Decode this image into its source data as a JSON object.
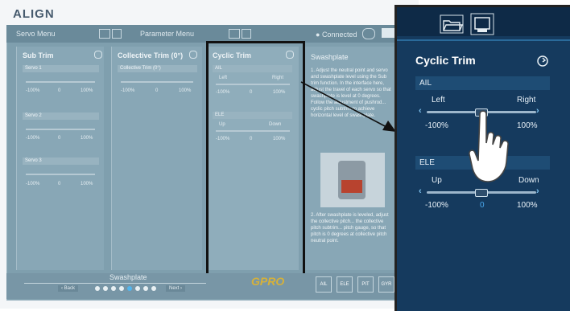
{
  "app": {
    "logo": "ALIGN",
    "menu_left": "Servo Menu",
    "menu_mid": "Parameter Menu",
    "connection_status": "Connected"
  },
  "columns": {
    "sub_trim": {
      "title": "Sub Trim",
      "servos": [
        "Servo 1",
        "Servo 2",
        "Servo 3"
      ],
      "min": "-100%",
      "mid": "0",
      "max": "100%"
    },
    "collective_trim": {
      "title": "Collective Trim (0°)",
      "label": "Collective Trim (0°)",
      "min": "-100%",
      "mid": "0",
      "max": "100%"
    },
    "cyclic_trim_small": {
      "title": "Cyclic Trim",
      "ail": "AIL",
      "ele": "ELE",
      "left": "Left",
      "right": "Right",
      "up": "Up",
      "down": "Down",
      "min": "-100%",
      "mid": "0",
      "max": "100%"
    },
    "swashplate": {
      "title": "Swashplate",
      "step1": "1. Adjust the neutral point and servo and swashplate level using the Sub trim function. In the interface here, adjust the travel of each servo so that swashplate is level at 0 degrees. Follow the adjustment of pushrod... cyclic pitch subtrim to achieve horizontal level of swashplate.",
      "step2": "2. After swashplate is leveled, adjust the collective pitch... the collective pitch subtrim... pitch gauge, so that pitch is 0 degrees at collective pitch neutral point."
    }
  },
  "bottom": {
    "label": "Swashplate",
    "back": "Back",
    "next": "Next",
    "page_count": 8,
    "active_page": 5,
    "brand": "GPRO",
    "icons": [
      "AIL",
      "ELE",
      "PIT",
      "GYR"
    ]
  },
  "zoom": {
    "title": "Cyclic Trim",
    "ail_label": "AIL",
    "left": "Left",
    "right": "Right",
    "ail_min": "-100%",
    "ail_max": "100%",
    "ele_label": "ELE",
    "up": "Up",
    "down": "Down",
    "ele_min": "-100%",
    "ele_mid": "0",
    "ele_max": "100%",
    "ail_value_fraction": 0.5,
    "ele_value_fraction": 0.5
  }
}
